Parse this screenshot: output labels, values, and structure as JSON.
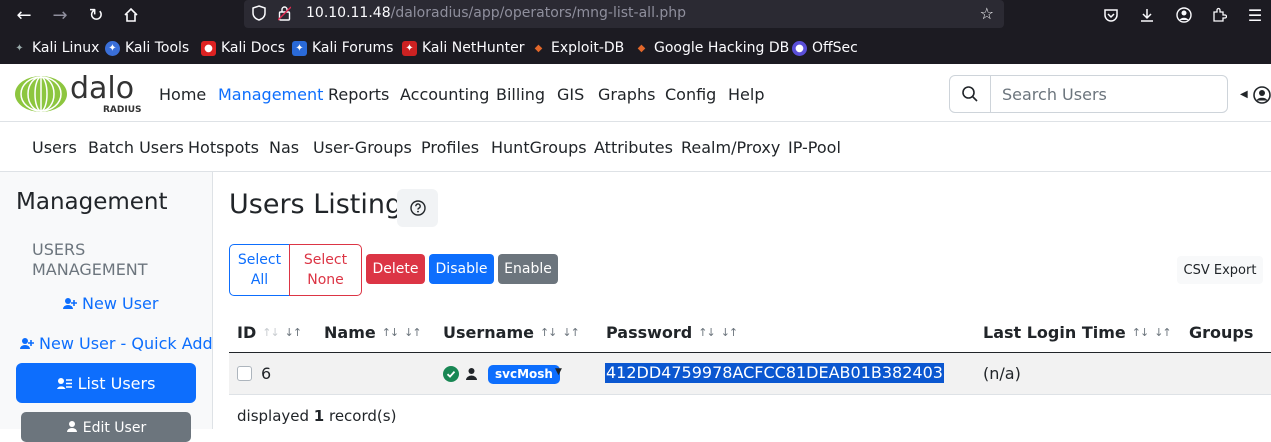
{
  "browser": {
    "url_host": "10.10.11.48",
    "url_path": "/daloradius/app/operators/mng-list-all.php",
    "bookmarks": [
      "Kali Linux",
      "Kali Tools",
      "Kali Docs",
      "Kali Forums",
      "Kali NetHunter",
      "Exploit-DB",
      "Google Hacking DB",
      "OffSec"
    ]
  },
  "header": {
    "logo_text": "dalo",
    "logo_sub": "RADIUS",
    "nav": [
      "Home",
      "Management",
      "Reports",
      "Accounting",
      "Billing",
      "GIS",
      "Graphs",
      "Config",
      "Help"
    ],
    "active_nav": "Management",
    "search_placeholder": "Search Users"
  },
  "subnav": [
    "Users",
    "Batch Users",
    "Hotspots",
    "Nas",
    "User-Groups",
    "Profiles",
    "HuntGroups",
    "Attributes",
    "Realm/Proxy",
    "IP-Pool"
  ],
  "sidebar": {
    "title": "Management",
    "section": "USERS MANAGEMENT",
    "new_user": "New User",
    "new_user_quick": "New User - Quick Add",
    "list_users": "List Users",
    "edit_user": "Edit User"
  },
  "main": {
    "title": "Users Listing",
    "buttons": {
      "select_all": "Select All",
      "select_none": "Select None",
      "delete": "Delete",
      "disable": "Disable",
      "enable": "Enable",
      "csv_export": "CSV Export"
    },
    "columns": [
      "ID",
      "Name",
      "Username",
      "Password",
      "Last Login Time",
      "Groups"
    ],
    "rows": [
      {
        "id": "6",
        "name": "",
        "username": "svcMosh",
        "password": "412DD4759978ACFCC81DEAB01B382403",
        "last_login": "(n/a)",
        "groups": ""
      }
    ],
    "footer_prefix": "displayed ",
    "footer_count": "1",
    "footer_suffix": " record(s)"
  },
  "colors": {
    "primary": "#0d6efd",
    "danger": "#dc3545",
    "secondary": "#6c757d",
    "success": "#198754",
    "logo_green": "#8dc63f"
  }
}
